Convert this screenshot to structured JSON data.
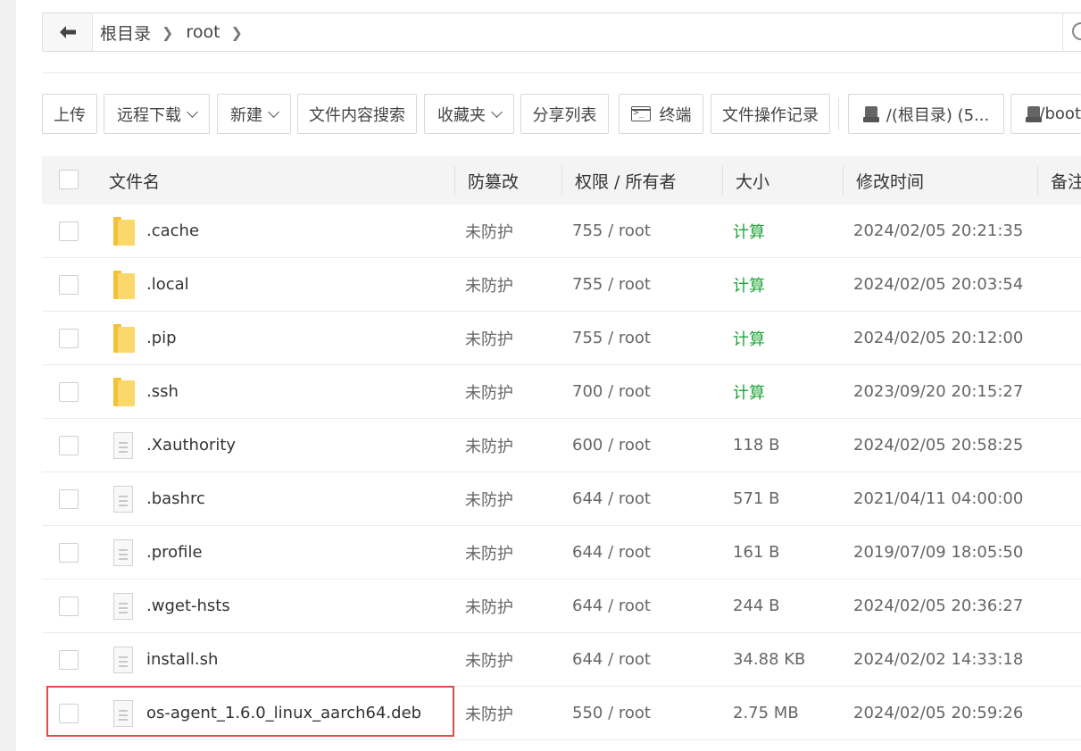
{
  "breadcrumb": {
    "items": [
      "根目录",
      "root"
    ]
  },
  "toolbar": {
    "upload": "上传",
    "remote_download": "远程下载",
    "new": "新建",
    "content_search": "文件内容搜索",
    "favorites": "收藏夹",
    "share_list": "分享列表",
    "terminal": "终端",
    "file_log": "文件操作记录",
    "disk_root": "/(根目录) (5...",
    "disk_boot": "/boot"
  },
  "table": {
    "headers": {
      "name": "文件名",
      "protect": "防篡改",
      "perm": "权限 / 所有者",
      "size": "大小",
      "mtime": "修改时间",
      "note": "备注"
    },
    "rows": [
      {
        "type": "folder",
        "name": ".cache",
        "protect": "未防护",
        "perm": "755 / root",
        "size": "计算",
        "mtime": "2024/02/05 20:21:35"
      },
      {
        "type": "folder",
        "name": ".local",
        "protect": "未防护",
        "perm": "755 / root",
        "size": "计算",
        "mtime": "2024/02/05 20:03:54"
      },
      {
        "type": "folder",
        "name": ".pip",
        "protect": "未防护",
        "perm": "755 / root",
        "size": "计算",
        "mtime": "2024/02/05 20:12:00"
      },
      {
        "type": "folder",
        "name": ".ssh",
        "protect": "未防护",
        "perm": "700 / root",
        "size": "计算",
        "mtime": "2023/09/20 20:15:27"
      },
      {
        "type": "file",
        "name": ".Xauthority",
        "protect": "未防护",
        "perm": "600 / root",
        "size": "118 B",
        "mtime": "2024/02/05 20:58:25"
      },
      {
        "type": "file",
        "name": ".bashrc",
        "protect": "未防护",
        "perm": "644 / root",
        "size": "571 B",
        "mtime": "2021/04/11 04:00:00"
      },
      {
        "type": "file",
        "name": ".profile",
        "protect": "未防护",
        "perm": "644 / root",
        "size": "161 B",
        "mtime": "2019/07/09 18:05:50"
      },
      {
        "type": "file",
        "name": ".wget-hsts",
        "protect": "未防护",
        "perm": "644 / root",
        "size": "244 B",
        "mtime": "2024/02/05 20:36:27"
      },
      {
        "type": "file",
        "name": "install.sh",
        "protect": "未防护",
        "perm": "644 / root",
        "size": "34.88 KB",
        "mtime": "2024/02/02 14:33:18"
      },
      {
        "type": "file",
        "name": "os-agent_1.6.0_linux_aarch64.deb",
        "protect": "未防护",
        "perm": "550 / root",
        "size": "2.75 MB",
        "mtime": "2024/02/05 20:59:26"
      }
    ]
  },
  "colors": {
    "calc_link": "#20a53a",
    "highlight_box": "#e04a4a",
    "folder": "#fbd86a"
  },
  "icons": {
    "back": "arrow-left-icon",
    "folder": "folder-icon",
    "file": "file-icon",
    "terminal": "terminal-icon",
    "disk": "disk-icon",
    "search": "search-icon"
  }
}
